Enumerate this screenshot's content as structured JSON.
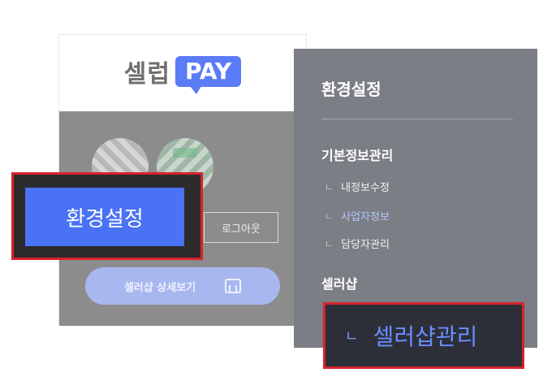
{
  "logo": {
    "text": "셀럽",
    "badge": "PAY"
  },
  "profile": {
    "logout_label": "로그아웃",
    "shop_detail_label": "셀러샵 상세보기"
  },
  "settings_button": {
    "label": "환경설정"
  },
  "menu": {
    "title": "환경설정",
    "section_basic": "기본정보관리",
    "items": [
      {
        "label": "내정보수정",
        "active": false
      },
      {
        "label": "사업자정보",
        "active": true
      },
      {
        "label": "담당자관리",
        "active": false
      }
    ],
    "section_shop": "셀러샵",
    "shop_item": {
      "label": "셀러샵관리"
    },
    "bullet": "ㄴ"
  },
  "colors": {
    "accent": "#4a72f5",
    "highlight_border": "#d7222d",
    "panel": "#7b7e84",
    "active_item": "#b7c6ff"
  }
}
